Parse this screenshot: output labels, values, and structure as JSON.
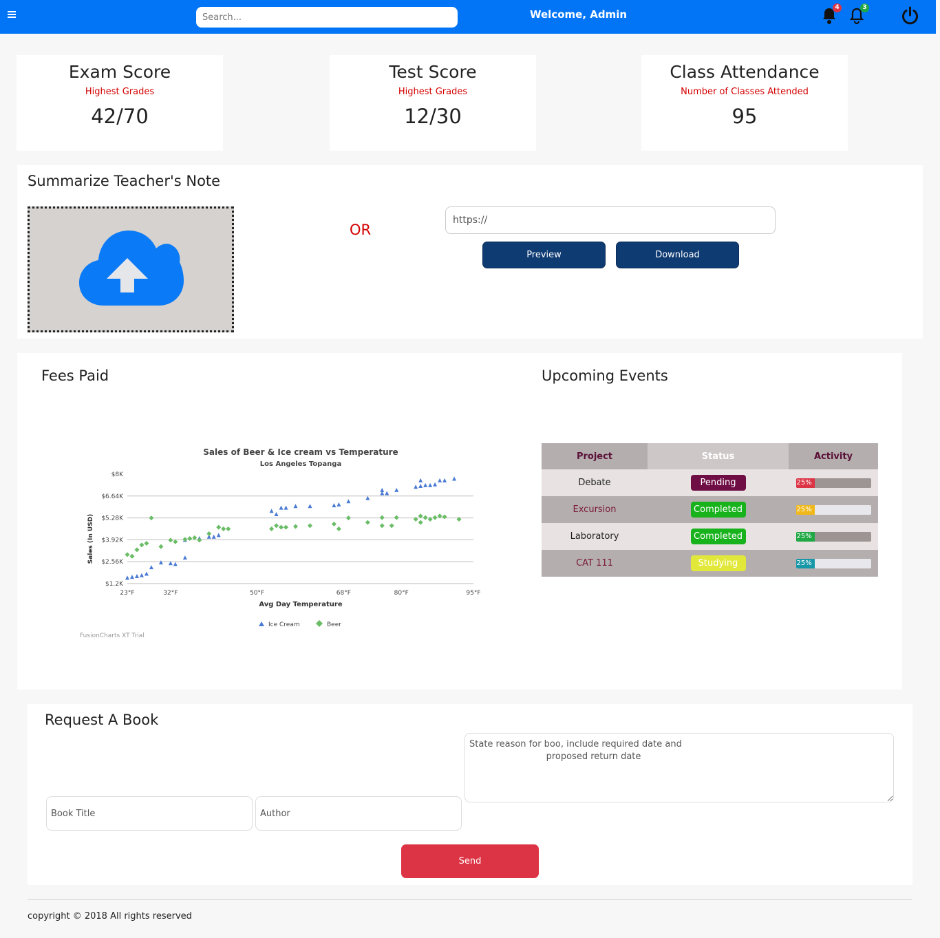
{
  "header": {
    "search_placeholder": "Search...",
    "welcome": "Welcome, Admin",
    "bell_badge_1": "4",
    "bell_badge_2": "3",
    "colors": {
      "bar": "#0275f7",
      "badge_red": "#dc3445",
      "badge_green": "#1fa844"
    }
  },
  "cards": [
    {
      "title": "Exam Score",
      "subtitle": "Highest Grades",
      "value": "42/70"
    },
    {
      "title": "Test Score",
      "subtitle": "Highest Grades",
      "value": "12/30"
    },
    {
      "title": "Class Attendance",
      "subtitle": "Number of Classes Attended",
      "value": "95"
    }
  ],
  "summarize": {
    "title": "Summarize Teacher's Note",
    "upload_icon": "cloud-upload-icon",
    "or_label": "OR",
    "url_placeholder": "https://",
    "preview_label": "Preview",
    "download_label": "Download"
  },
  "fees": {
    "title": "Fees Paid"
  },
  "events": {
    "title": "Upcoming Events",
    "headers": [
      "Project",
      "Status",
      "Activity"
    ],
    "rows": [
      {
        "project": "Debate",
        "status": "Pending",
        "status_color": "#6f0e45",
        "status_text_color": "#ffffff",
        "progress": 25,
        "progress_label": "25%",
        "progress_color": "#dc3445",
        "track_color": "#9d9494"
      },
      {
        "project": "Excursion",
        "status": "Completed",
        "status_color": "#17b21c",
        "status_text_color": "#ffffff",
        "progress": 25,
        "progress_label": "25%",
        "progress_color": "#f0b81b",
        "track_color": "#e8e8ec"
      },
      {
        "project": "Laboratory",
        "status": "Completed",
        "status_color": "#17b21c",
        "status_text_color": "#ffffff",
        "progress": 25,
        "progress_label": "25%",
        "progress_color": "#1fa844",
        "track_color": "#9d9494"
      },
      {
        "project": "CAT 111",
        "status": "Studying",
        "status_color": "#e2e83a",
        "status_text_color": "#ffffff",
        "progress": 25,
        "progress_label": "25%",
        "progress_color": "#1798a8",
        "track_color": "#e8e8ec"
      }
    ]
  },
  "request": {
    "title": "Request A Book",
    "reason_placeholder": "State reason for boo, include required date and\n                           proposed return date",
    "title_placeholder": "Book Title",
    "author_placeholder": "Author",
    "send_label": "Send"
  },
  "footer": {
    "text": "copyright © 2018 All rights reserved"
  },
  "chart_data": {
    "type": "scatter",
    "title": "Sales of Beer & Ice cream vs Temperature",
    "subtitle": "Los Angeles Topanga",
    "xlabel": "Avg Day Temperature",
    "ylabel": "Sales (In USD)",
    "xlim": [
      23,
      95
    ],
    "ylim": [
      1200,
      8000
    ],
    "x_ticks": [
      23,
      32,
      50,
      68,
      80,
      95
    ],
    "x_tick_labels": [
      "23°F",
      "32°F",
      "50°F",
      "68°F",
      "80°F",
      "95°F"
    ],
    "y_ticks": [
      1200,
      2560,
      3920,
      5280,
      6640,
      8000
    ],
    "y_tick_labels": [
      "$1.2K",
      "$2.56K",
      "$3.92K",
      "$5.28K",
      "$6.64K",
      "$8K"
    ],
    "grid": true,
    "legend": "bottom-center",
    "watermark": "FusionCharts XT Trial",
    "series": [
      {
        "name": "Ice Cream",
        "marker": "triangle",
        "color": "#4a7bd4",
        "points": [
          [
            23,
            1550
          ],
          [
            24,
            1600
          ],
          [
            25,
            1650
          ],
          [
            26,
            1700
          ],
          [
            27,
            1800
          ],
          [
            28,
            2200
          ],
          [
            30,
            2500
          ],
          [
            32,
            2450
          ],
          [
            33,
            2400
          ],
          [
            35,
            3900
          ],
          [
            35,
            2800
          ],
          [
            38,
            4000
          ],
          [
            40,
            4100
          ],
          [
            41,
            4100
          ],
          [
            42,
            4200
          ],
          [
            53,
            5700
          ],
          [
            54,
            5500
          ],
          [
            55,
            5900
          ],
          [
            56,
            5900
          ],
          [
            58,
            6000
          ],
          [
            61,
            6000
          ],
          [
            66,
            6050
          ],
          [
            67,
            6100
          ],
          [
            69,
            6300
          ],
          [
            73,
            6500
          ],
          [
            76,
            7000
          ],
          [
            76,
            6800
          ],
          [
            77,
            6800
          ],
          [
            79,
            7000
          ],
          [
            83,
            7200
          ],
          [
            84,
            7250
          ],
          [
            84,
            7600
          ],
          [
            85,
            7300
          ],
          [
            86,
            7300
          ],
          [
            87,
            7350
          ],
          [
            88,
            7600
          ],
          [
            89,
            7600
          ],
          [
            91,
            7700
          ]
        ],
        "values": []
      },
      {
        "name": "Beer",
        "marker": "diamond",
        "color": "#6abd66",
        "points": [
          [
            23,
            3000
          ],
          [
            24,
            2900
          ],
          [
            25,
            3300
          ],
          [
            26,
            3600
          ],
          [
            27,
            3700
          ],
          [
            28,
            5280
          ],
          [
            30,
            3500
          ],
          [
            32,
            3900
          ],
          [
            33,
            3800
          ],
          [
            35,
            3950
          ],
          [
            36,
            4000
          ],
          [
            37,
            4050
          ],
          [
            38,
            3900
          ],
          [
            40,
            4300
          ],
          [
            42,
            4700
          ],
          [
            43,
            4600
          ],
          [
            44,
            4600
          ],
          [
            53,
            4600
          ],
          [
            54,
            4800
          ],
          [
            55,
            4700
          ],
          [
            56,
            4700
          ],
          [
            58,
            4750
          ],
          [
            61,
            4800
          ],
          [
            66,
            4900
          ],
          [
            67,
            4600
          ],
          [
            69,
            5280
          ],
          [
            73,
            5000
          ],
          [
            76,
            5300
          ],
          [
            76,
            4800
          ],
          [
            78,
            4800
          ],
          [
            79,
            5300
          ],
          [
            83,
            5200
          ],
          [
            84,
            5000
          ],
          [
            84,
            5400
          ],
          [
            85,
            5300
          ],
          [
            86,
            5200
          ],
          [
            87,
            5300
          ],
          [
            88,
            5400
          ],
          [
            89,
            5350
          ],
          [
            92,
            5200
          ]
        ],
        "values": []
      }
    ]
  }
}
